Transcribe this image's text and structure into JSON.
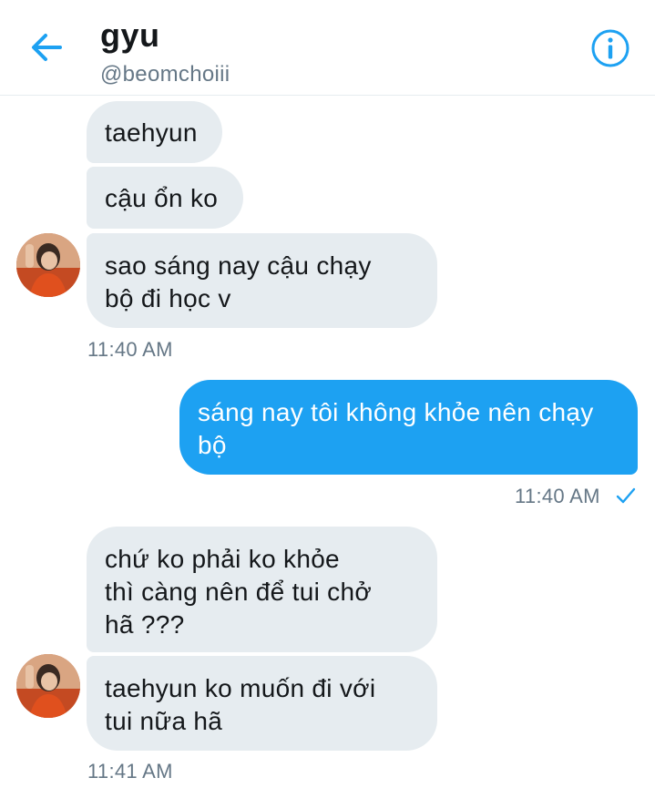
{
  "header": {
    "name": "gyu",
    "handle": "@beomchoiii",
    "back_icon": "arrow-left-icon",
    "info_icon": "info-circle-icon",
    "accent_color": "#1da1f2"
  },
  "messages": [
    {
      "sender": "them",
      "text": "taehyun"
    },
    {
      "sender": "them",
      "text": "cậu ổn ko"
    },
    {
      "sender": "them",
      "lines": [
        "sao sáng nay cậu chạy",
        "bộ đi học v"
      ]
    },
    {
      "sender": "them",
      "timestamp": "11:40 AM"
    },
    {
      "sender": "me",
      "lines": [
        "sáng nay tôi không khỏe nên chạy",
        "bộ"
      ]
    },
    {
      "sender": "me",
      "timestamp": "11:40 AM",
      "status_icon": "read-check-icon"
    },
    {
      "sender": "them",
      "lines": [
        "chứ ko phải ko khỏe",
        "thì càng nên để tui chở",
        "hã ???"
      ]
    },
    {
      "sender": "them",
      "lines": [
        "taehyun ko muốn đi với",
        "tui nữa hã"
      ]
    },
    {
      "sender": "them",
      "timestamp": "11:41 AM"
    }
  ],
  "colors": {
    "incoming_bubble": "#e6ecf0",
    "outgoing_bubble": "#1da1f2",
    "timestamp": "#657786"
  }
}
